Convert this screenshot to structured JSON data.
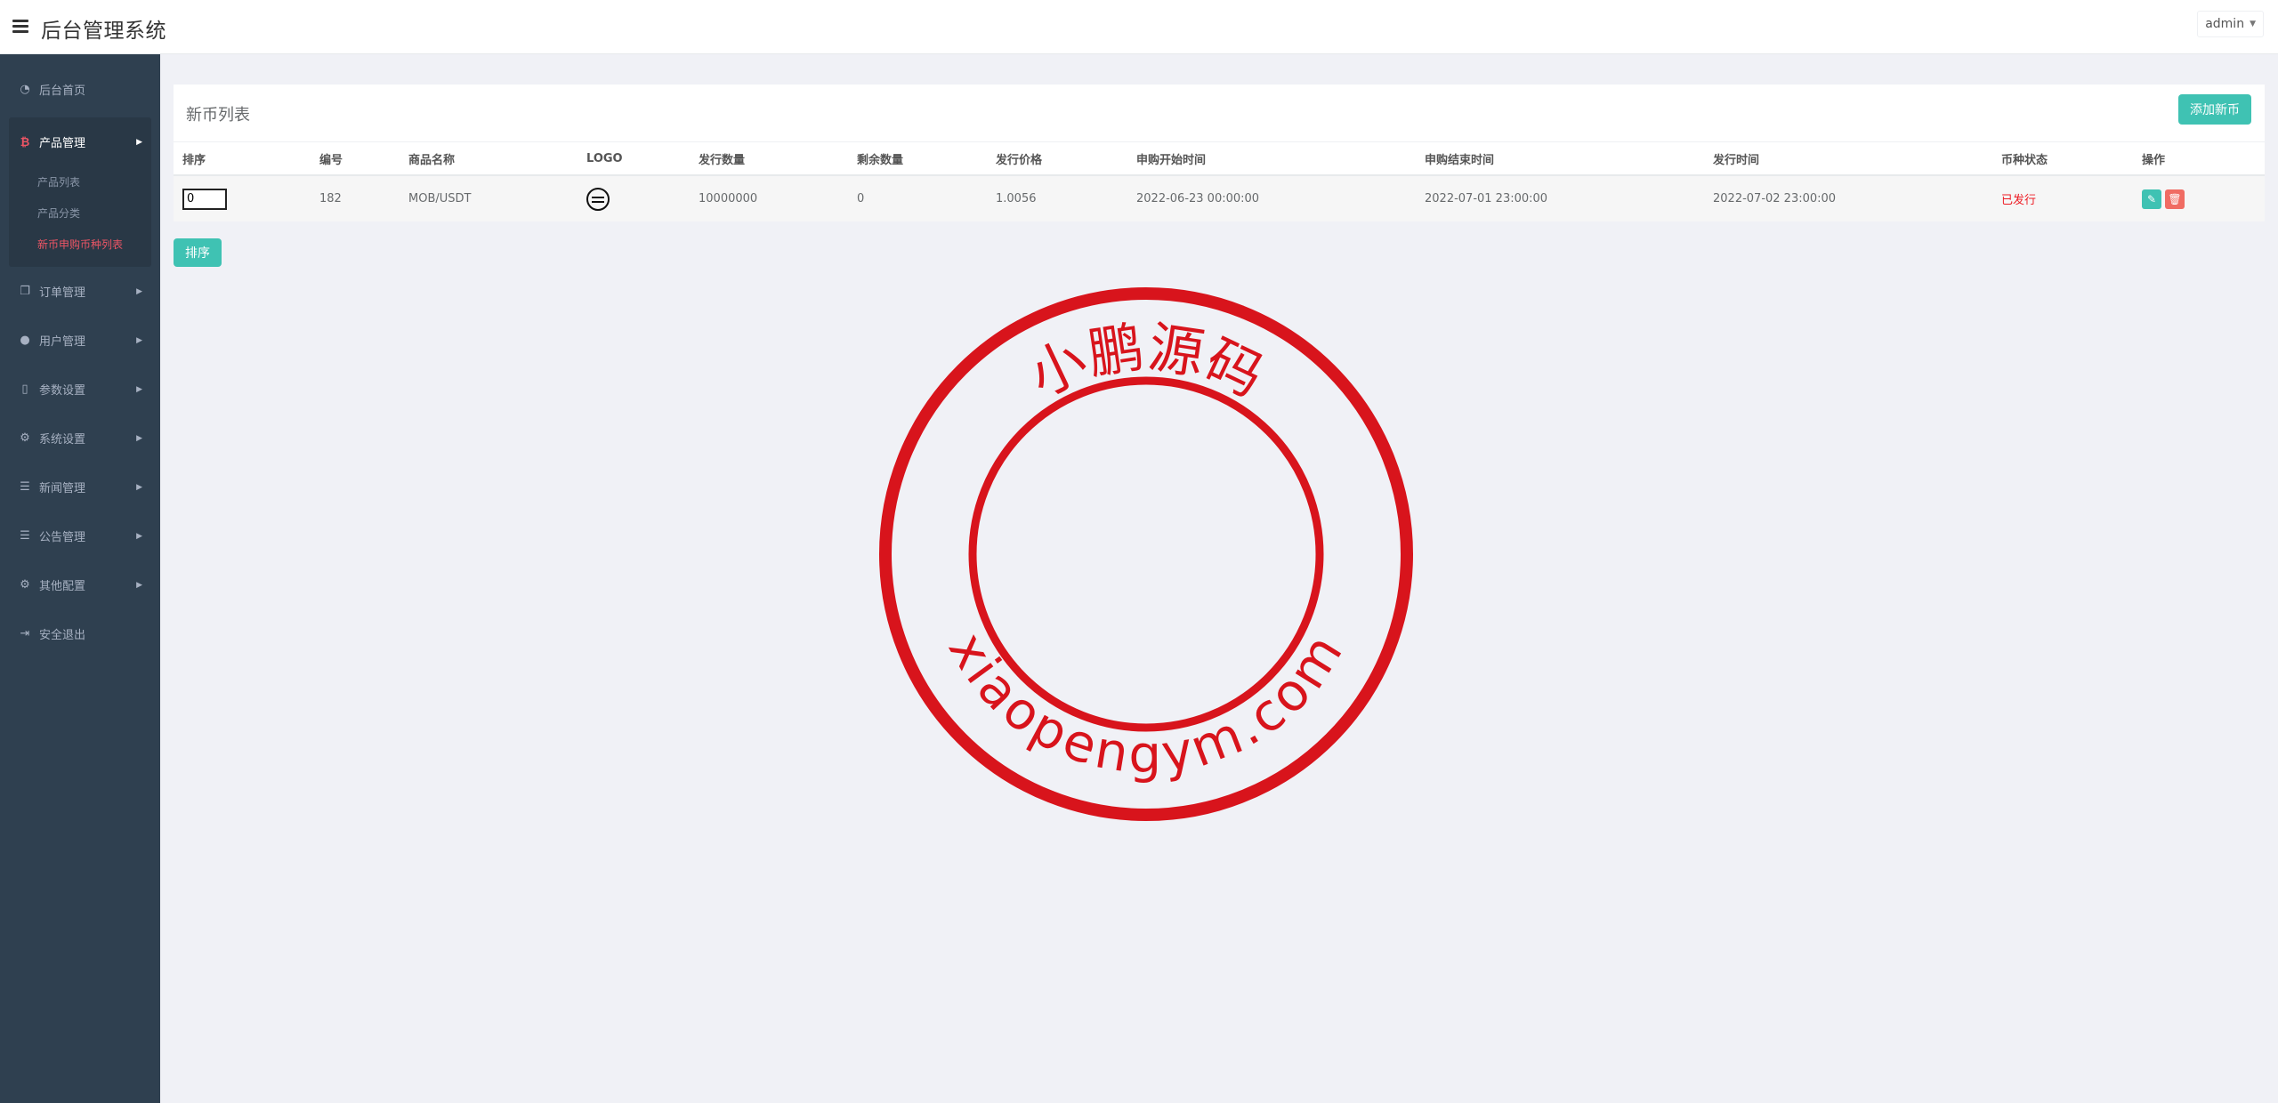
{
  "header": {
    "app_title": "后台管理系统",
    "user": "admin"
  },
  "sidebar": {
    "items": [
      {
        "label": "后台首页",
        "icon": "dashboard-icon"
      },
      {
        "label": "产品管理",
        "icon": "bitcoin-icon",
        "expanded": true,
        "children": [
          {
            "label": "产品列表",
            "active": false
          },
          {
            "label": "产品分类",
            "active": false
          },
          {
            "label": "新币申购币种列表",
            "active": true
          }
        ]
      },
      {
        "label": "订单管理",
        "icon": "copy-icon"
      },
      {
        "label": "用户管理",
        "icon": "user-icon"
      },
      {
        "label": "参数设置",
        "icon": "file-icon"
      },
      {
        "label": "系统设置",
        "icon": "gears-icon"
      },
      {
        "label": "新闻管理",
        "icon": "list-icon"
      },
      {
        "label": "公告管理",
        "icon": "list-icon"
      },
      {
        "label": "其他配置",
        "icon": "gear-icon"
      },
      {
        "label": "安全退出",
        "icon": "sign-out-icon"
      }
    ]
  },
  "panel": {
    "title": "新币列表",
    "add_button": "添加新币",
    "sort_button": "排序"
  },
  "table": {
    "columns": [
      "排序",
      "编号",
      "商品名称",
      "LOGO",
      "发行数量",
      "剩余数量",
      "发行价格",
      "申购开始时间",
      "申购结束时间",
      "发行时间",
      "币种状态",
      "操作"
    ],
    "rows": [
      {
        "sort": "0",
        "id": "182",
        "name": "MOB/USDT",
        "logo": "mob-coin-logo",
        "issue_qty": "10000000",
        "remaining_qty": "0",
        "issue_price": "1.0056",
        "start_time": "2022-06-23 00:00:00",
        "end_time": "2022-07-01 23:00:00",
        "issue_time": "2022-07-02 23:00:00",
        "status": "已发行"
      }
    ]
  },
  "watermark": {
    "top_text": "小鹏源码",
    "bottom_text": "xiaopengym.com",
    "color": "#d8141c"
  },
  "colors": {
    "sidebar_bg": "#2f4050",
    "accent": "#3fc2b3",
    "danger": "#f06c63",
    "active_red": "#ed5565"
  }
}
